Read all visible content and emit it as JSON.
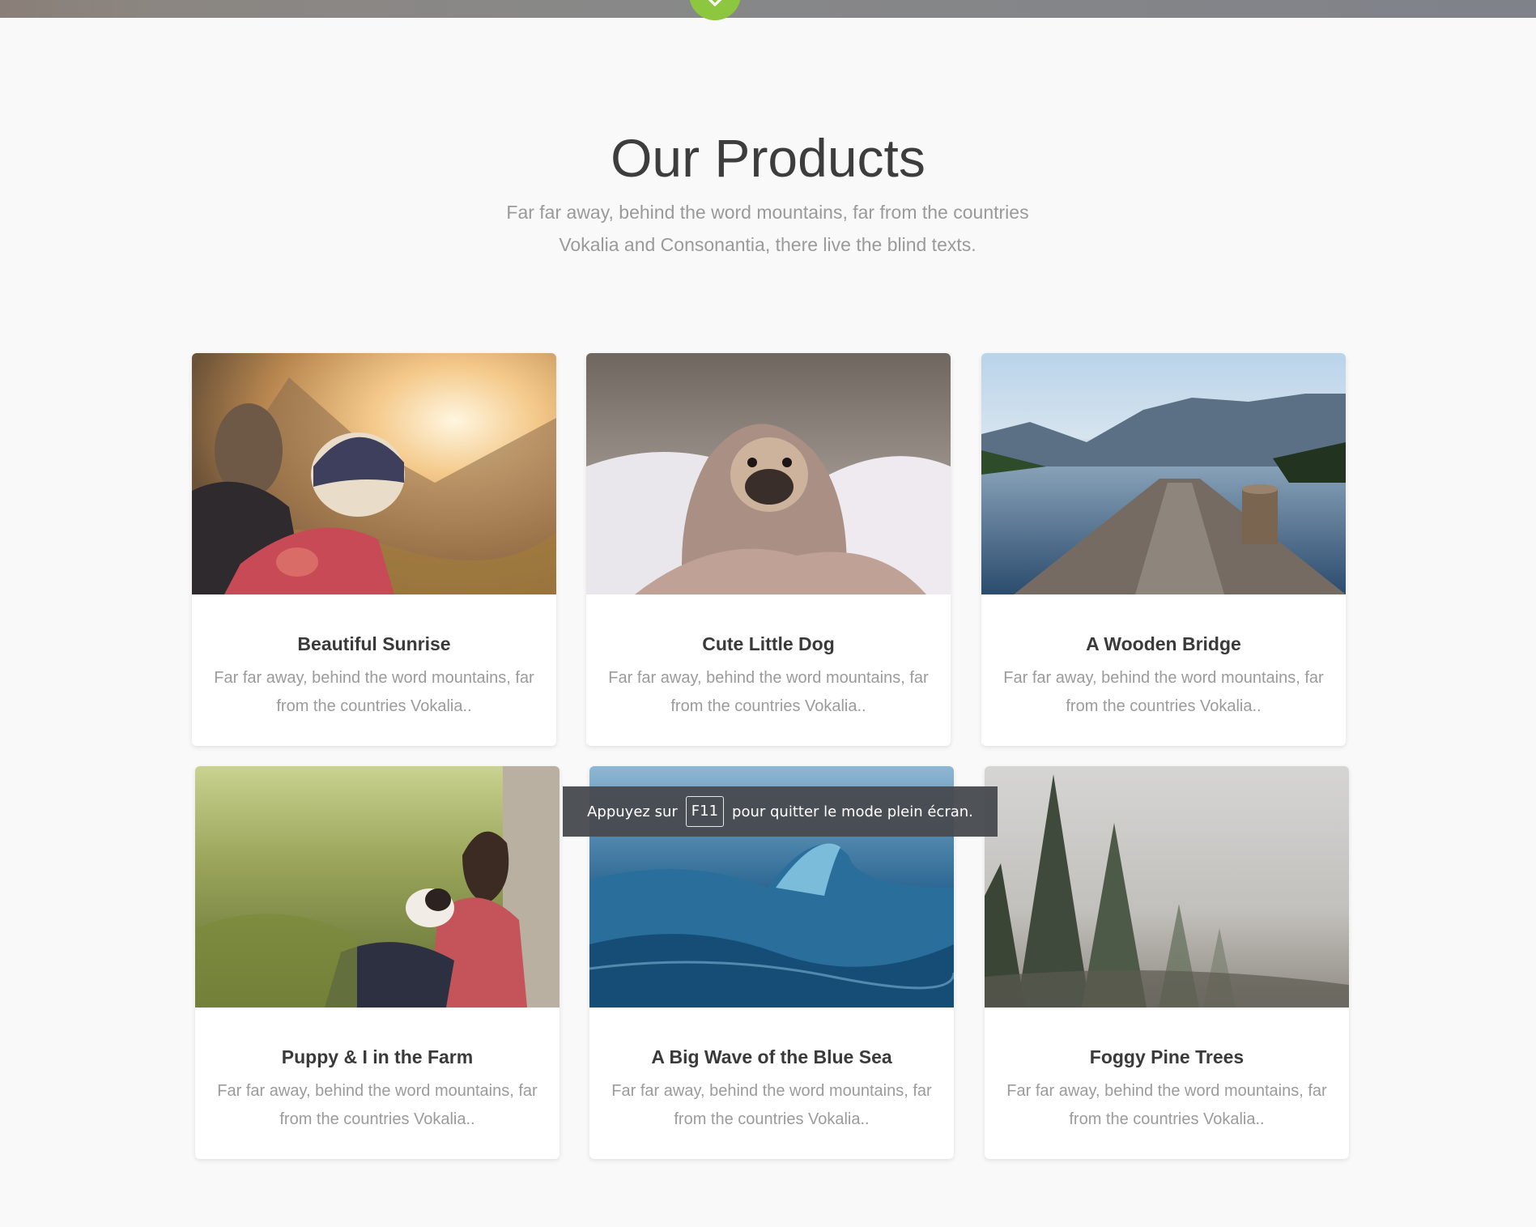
{
  "section": {
    "title": "Our Products",
    "subtitle": "Far far away, behind the word mountains, far from the countries Vokalia and Consonantia, there live the blind texts."
  },
  "products": [
    {
      "title": "Beautiful Sunrise",
      "text": "Far far away, behind the word mountains, far from the countries Vokalia.."
    },
    {
      "title": "Cute Little Dog",
      "text": "Far far away, behind the word mountains, far from the countries Vokalia.."
    },
    {
      "title": "A Wooden Bridge",
      "text": "Far far away, behind the word mountains, far from the countries Vokalia.."
    },
    {
      "title": "Puppy & I in the Farm",
      "text": "Far far away, behind the word mountains, far from the countries Vokalia.."
    },
    {
      "title": "A Big Wave of the Blue Sea",
      "text": "Far far away, behind the word mountains, far from the countries Vokalia.."
    },
    {
      "title": "Foggy Pine Trees",
      "text": "Far far away, behind the word mountains, far from the countries Vokalia.."
    }
  ],
  "fullscreen_notice": {
    "before": "Appuyez sur",
    "key": "F11",
    "after": "pour quitter le mode plein écran."
  },
  "icons": {
    "scroll_down": "chevron-down-icon"
  },
  "colors": {
    "accent": "#8dc63f",
    "title": "#3d3d3d",
    "muted_text": "#9b9b9b",
    "background": "#f9f9f9"
  }
}
